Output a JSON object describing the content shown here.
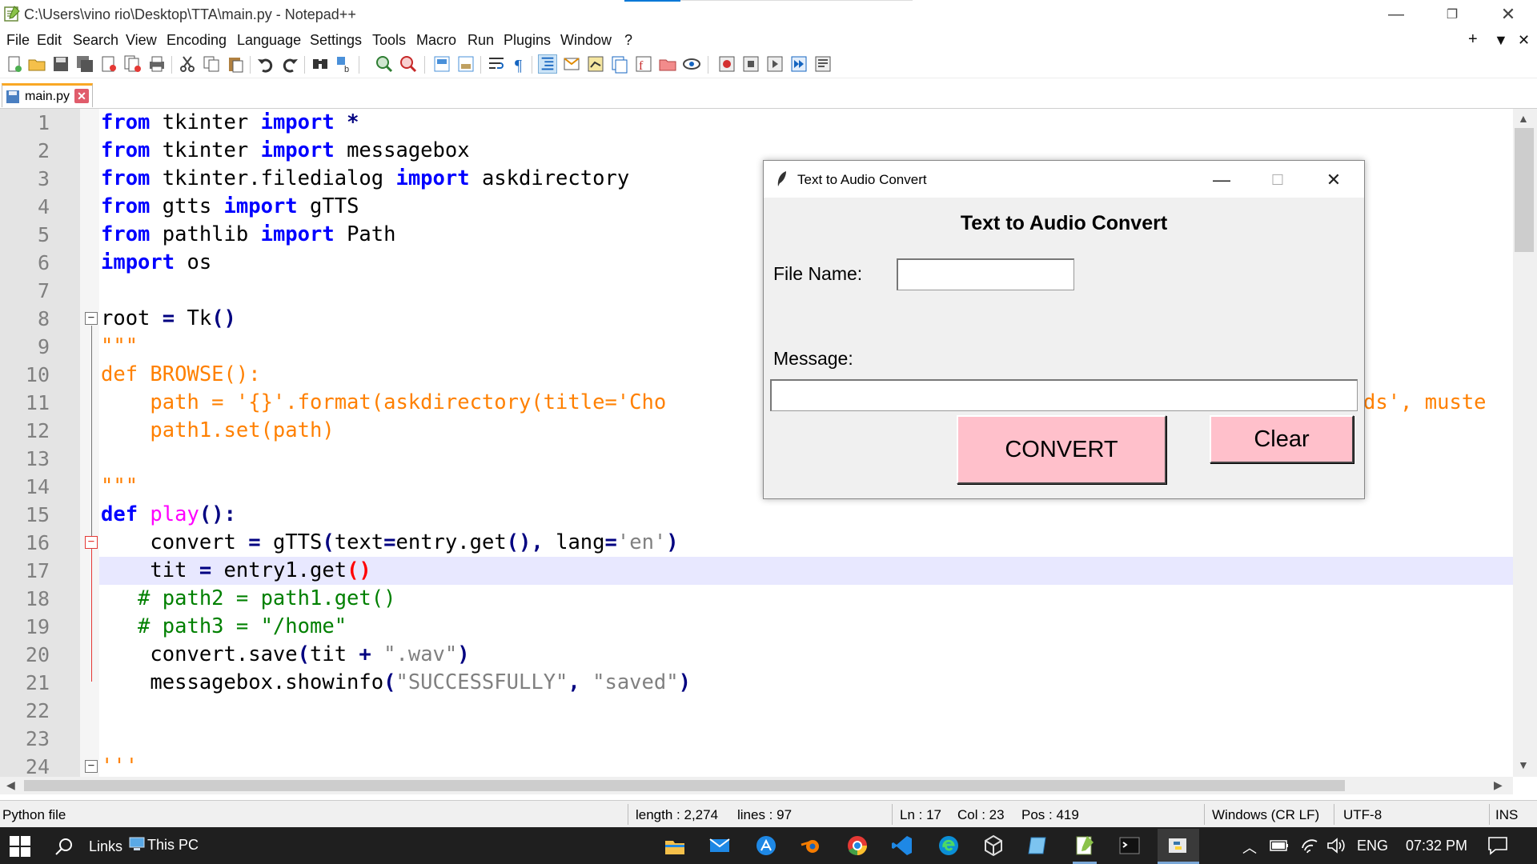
{
  "window": {
    "title": "C:\\Users\\vino rio\\Desktop\\TTA\\main.py - Notepad++",
    "menu_extra": [
      "+",
      "▼",
      "✕"
    ]
  },
  "menu": [
    "File",
    "Edit",
    "Search",
    "View",
    "Encoding",
    "Language",
    "Settings",
    "Tools",
    "Macro",
    "Run",
    "Plugins",
    "Window",
    "?"
  ],
  "tab": {
    "label": "main.py"
  },
  "editor": {
    "line_numbers": [
      "1",
      "2",
      "3",
      "4",
      "5",
      "6",
      "7",
      "8",
      "9",
      "10",
      "11",
      "12",
      "13",
      "14",
      "15",
      "16",
      "17",
      "18",
      "19",
      "20",
      "21",
      "22",
      "23",
      "24"
    ],
    "lines": [
      "from tkinter import *",
      "from tkinter import messagebox",
      "from tkinter.filedialog import askdirectory",
      "from gtts import gTTS",
      "from pathlib import Path",
      "import os",
      "",
      "root = Tk()",
      "\"\"\"",
      "def BROWSE():",
      "    path = '{}'.format(askdirectory(title='Cho",
      "    path1.set(path)",
      "",
      "\"\"\"",
      "def play():",
      "    convert = gTTS(text=entry.get(), lang='en')",
      "    tit = entry1.get()",
      "   # path2 = path1.get()",
      "   # path3 = \"/home\"",
      "    convert.save(tit + \".wav\")",
      "    messagebox.showinfo(\"SUCCESSFULLY\", \"saved\")",
      "",
      "",
      "'''"
    ],
    "line11_tail": "ds', muste"
  },
  "statusbar": {
    "filetype": "Python file",
    "length": "length : 2,274",
    "lines": "lines : 97",
    "ln": "Ln : 17",
    "col": "Col : 23",
    "pos": "Pos : 419",
    "eol": "Windows (CR LF)",
    "encoding": "UTF-8",
    "mode": "INS"
  },
  "taskbar": {
    "links": "Links",
    "thispc": "This PC",
    "lang": "ENG",
    "time": "07:32 PM"
  },
  "dialog": {
    "title": "Text to Audio Convert",
    "heading": "Text to Audio Convert",
    "file_name_label": "File Name:",
    "file_name_value": "",
    "message_label": "Message:",
    "message_value": "",
    "convert_label": "CONVERT",
    "clear_label": "Clear"
  }
}
